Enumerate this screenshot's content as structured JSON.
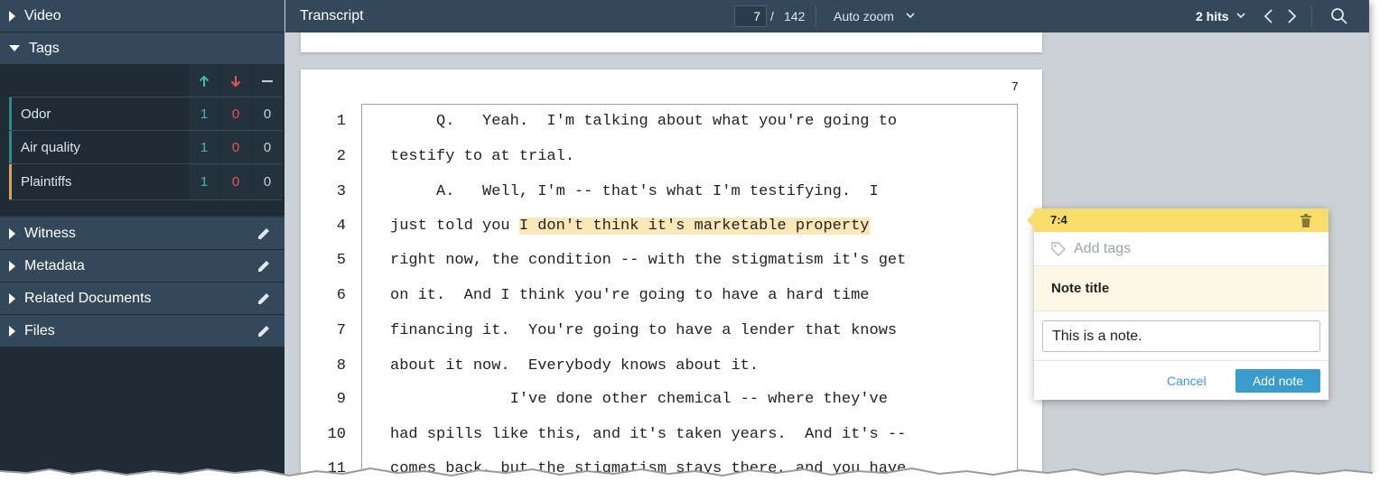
{
  "sidebar": {
    "video": {
      "label": "Video"
    },
    "tags": {
      "label": "Tags",
      "rows": [
        {
          "name": "Odor",
          "up": "1",
          "down": "0",
          "neutral": "0",
          "color": "#2f8a86"
        },
        {
          "name": "Air quality",
          "up": "1",
          "down": "0",
          "neutral": "0",
          "color": "#2f8a86"
        },
        {
          "name": "Plaintiffs",
          "up": "1",
          "down": "0",
          "neutral": "0",
          "color": "#d9a15a"
        }
      ]
    },
    "witness": {
      "label": "Witness"
    },
    "metadata": {
      "label": "Metadata"
    },
    "related": {
      "label": "Related Documents"
    },
    "files": {
      "label": "Files"
    }
  },
  "toolbar": {
    "title": "Transcript",
    "page_current": "7",
    "page_sep": "/",
    "page_total": "142",
    "zoom": "Auto zoom",
    "hits": "2 hits"
  },
  "document": {
    "page_number": "7",
    "lines": [
      {
        "n": "1",
        "text": "     Q.   Yeah.  I'm talking about what you're going to"
      },
      {
        "n": "2",
        "text": "testify to at trial."
      },
      {
        "n": "3",
        "text": "     A.   Well, I'm -- that's what I'm testifying.  I"
      },
      {
        "n": "4",
        "pre": "just told you ",
        "highlight": "I don't think it's marketable property"
      },
      {
        "n": "5",
        "text": "right now, the condition -- with the stigmatism it's get"
      },
      {
        "n": "6",
        "text": "on it.  And I think you're going to have a hard time"
      },
      {
        "n": "7",
        "text": "financing it.  You're going to have a lender that knows"
      },
      {
        "n": "8",
        "text": "about it now.  Everybody knows about it."
      },
      {
        "n": "9",
        "text": "             I've done other chemical -- where they've"
      },
      {
        "n": "10",
        "text": "had spills like this, and it's taken years.  And it's --"
      },
      {
        "n": "11",
        "text": "comes back, but the stigmatism stays there, and you have"
      }
    ]
  },
  "note": {
    "ref": "7:4",
    "tags_placeholder": "Add tags",
    "title_label": "Note title",
    "body": "This is a note.",
    "cancel_label": "Cancel",
    "add_label": "Add note"
  },
  "colors": {
    "sidebar_bg": "#1f2b35",
    "header_bg": "#33485a",
    "up": "#3fb8b0",
    "down": "#ef5350",
    "highlight": "#fbe8b8",
    "note_header": "#f9dd6b",
    "accent": "#3a9ccc"
  }
}
